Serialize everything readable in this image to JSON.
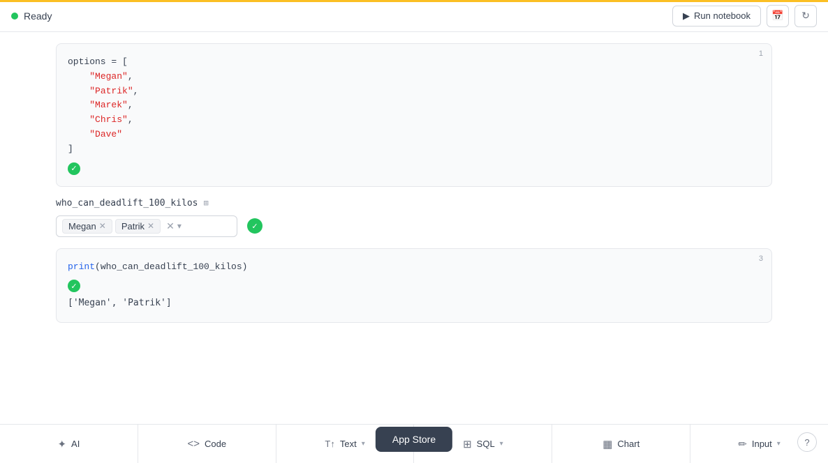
{
  "topBar": {
    "status": "Ready",
    "runLabel": "Run notebook",
    "calendarIcon": "calendar",
    "refreshIcon": "refresh"
  },
  "cell1": {
    "number": "1",
    "code": [
      "options = [",
      "    \"Megan\",",
      "    \"Patrik\",",
      "    \"Marek\",",
      "    \"Chris\",",
      "    \"Dave\"",
      "]"
    ]
  },
  "inputCell": {
    "label": "who_can_deadlift_100_kilos",
    "tags": [
      "Megan",
      "Patrik"
    ]
  },
  "cell3": {
    "number": "3",
    "code": "print(who_can_deadlift_100_kilos)",
    "output": "['Megan', 'Patrik']"
  },
  "toolbar": {
    "items": [
      {
        "id": "ai",
        "label": "AI",
        "icon": "✦",
        "hasDropdown": false
      },
      {
        "id": "code",
        "label": "Code",
        "icon": "<>",
        "hasDropdown": false
      },
      {
        "id": "text",
        "label": "Text",
        "icon": "T↑",
        "hasDropdown": true
      },
      {
        "id": "sql",
        "label": "SQL",
        "icon": "⊞",
        "hasDropdown": true
      },
      {
        "id": "chart",
        "label": "Chart",
        "icon": "▦",
        "hasDropdown": false
      },
      {
        "id": "input",
        "label": "Input",
        "icon": "✏",
        "hasDropdown": true
      }
    ]
  },
  "appStore": {
    "label": "App Store"
  },
  "helpIcon": "?"
}
